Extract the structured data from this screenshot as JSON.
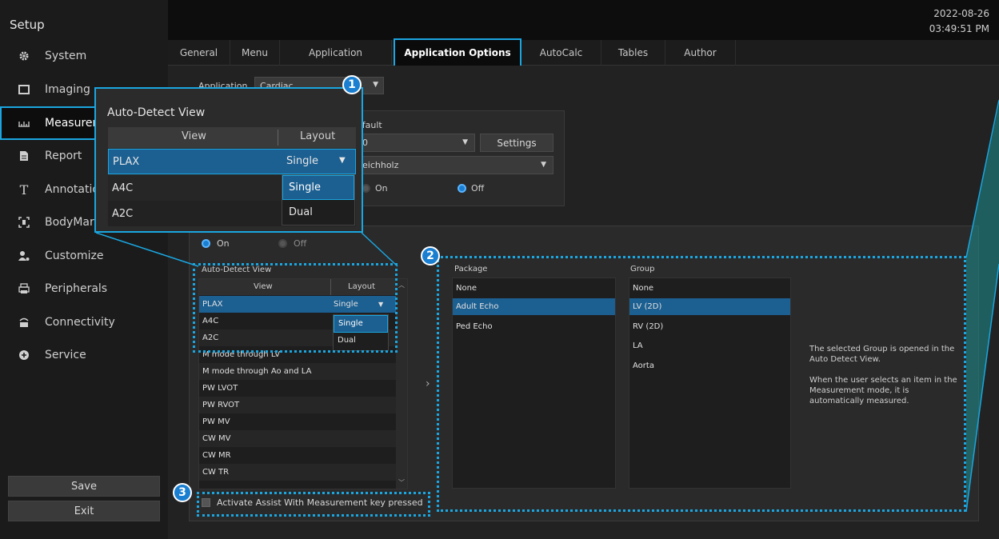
{
  "sidebar": {
    "title": "Setup",
    "items": [
      {
        "label": "System",
        "icon": "gear-icon"
      },
      {
        "label": "Imaging",
        "icon": "monitor-icon"
      },
      {
        "label": "Measuren",
        "icon": "ruler-icon"
      },
      {
        "label": "Report",
        "icon": "document-icon"
      },
      {
        "label": "Annotatio",
        "icon": "text-icon"
      },
      {
        "label": "BodyMark",
        "icon": "bodymark-icon"
      },
      {
        "label": "Customize",
        "icon": "user-icon"
      },
      {
        "label": "Peripherals",
        "icon": "printer-icon"
      },
      {
        "label": "Connectivity",
        "icon": "network-icon"
      },
      {
        "label": "Service",
        "icon": "service-icon"
      }
    ],
    "save_label": "Save",
    "exit_label": "Exit"
  },
  "header": {
    "date": "2022-08-26",
    "time": "03:49:51 PM"
  },
  "tabs": [
    "General",
    "Menu",
    "Application",
    "Application Options",
    "AutoCalc",
    "Tables",
    "Author"
  ],
  "form": {
    "application_label": "Application",
    "application_value": "Cardiac",
    "default_label": "efault",
    "combo1_value": "0",
    "settings_label": "Settings",
    "combo2_value": "eichholz",
    "radio_on": "On",
    "radio_off": "Off",
    "assist_on": "On",
    "assist_off": "Off"
  },
  "auto_detect": {
    "title": "Auto-Detect View",
    "col_view": "View",
    "col_layout": "Layout",
    "rows": [
      {
        "view": "PLAX",
        "layout": "Single"
      },
      {
        "view": "A4C",
        "layout": ""
      },
      {
        "view": "A2C",
        "layout": ""
      },
      {
        "view": "M mode through LV",
        "layout": ""
      },
      {
        "view": "M mode through Ao and LA",
        "layout": ""
      },
      {
        "view": "PW LVOT",
        "layout": ""
      },
      {
        "view": "PW RVOT",
        "layout": ""
      },
      {
        "view": "PW MV",
        "layout": ""
      },
      {
        "view": "CW MV",
        "layout": ""
      },
      {
        "view": "CW MR",
        "layout": ""
      },
      {
        "view": "CW TR",
        "layout": ""
      }
    ],
    "layout_options": [
      "Single",
      "Dual"
    ]
  },
  "package": {
    "label": "Package",
    "items": [
      "None",
      "Adult Echo",
      "Ped Echo"
    ],
    "selected": 1
  },
  "group": {
    "label": "Group",
    "items": [
      "None",
      "LV (2D)",
      "RV (2D)",
      "LA",
      "Aorta"
    ],
    "selected": 1
  },
  "description": {
    "p1": "The selected Group is opened in the Auto Detect View.",
    "p2": "When the user selects an item in the Measurement mode, it is automatically measured."
  },
  "assist_checkbox_label": "Activate Assist With Measurement key pressed",
  "callouts": [
    "1",
    "2",
    "3"
  ],
  "colors": {
    "accent": "#1aa6e0",
    "selection": "#1c5f91"
  }
}
